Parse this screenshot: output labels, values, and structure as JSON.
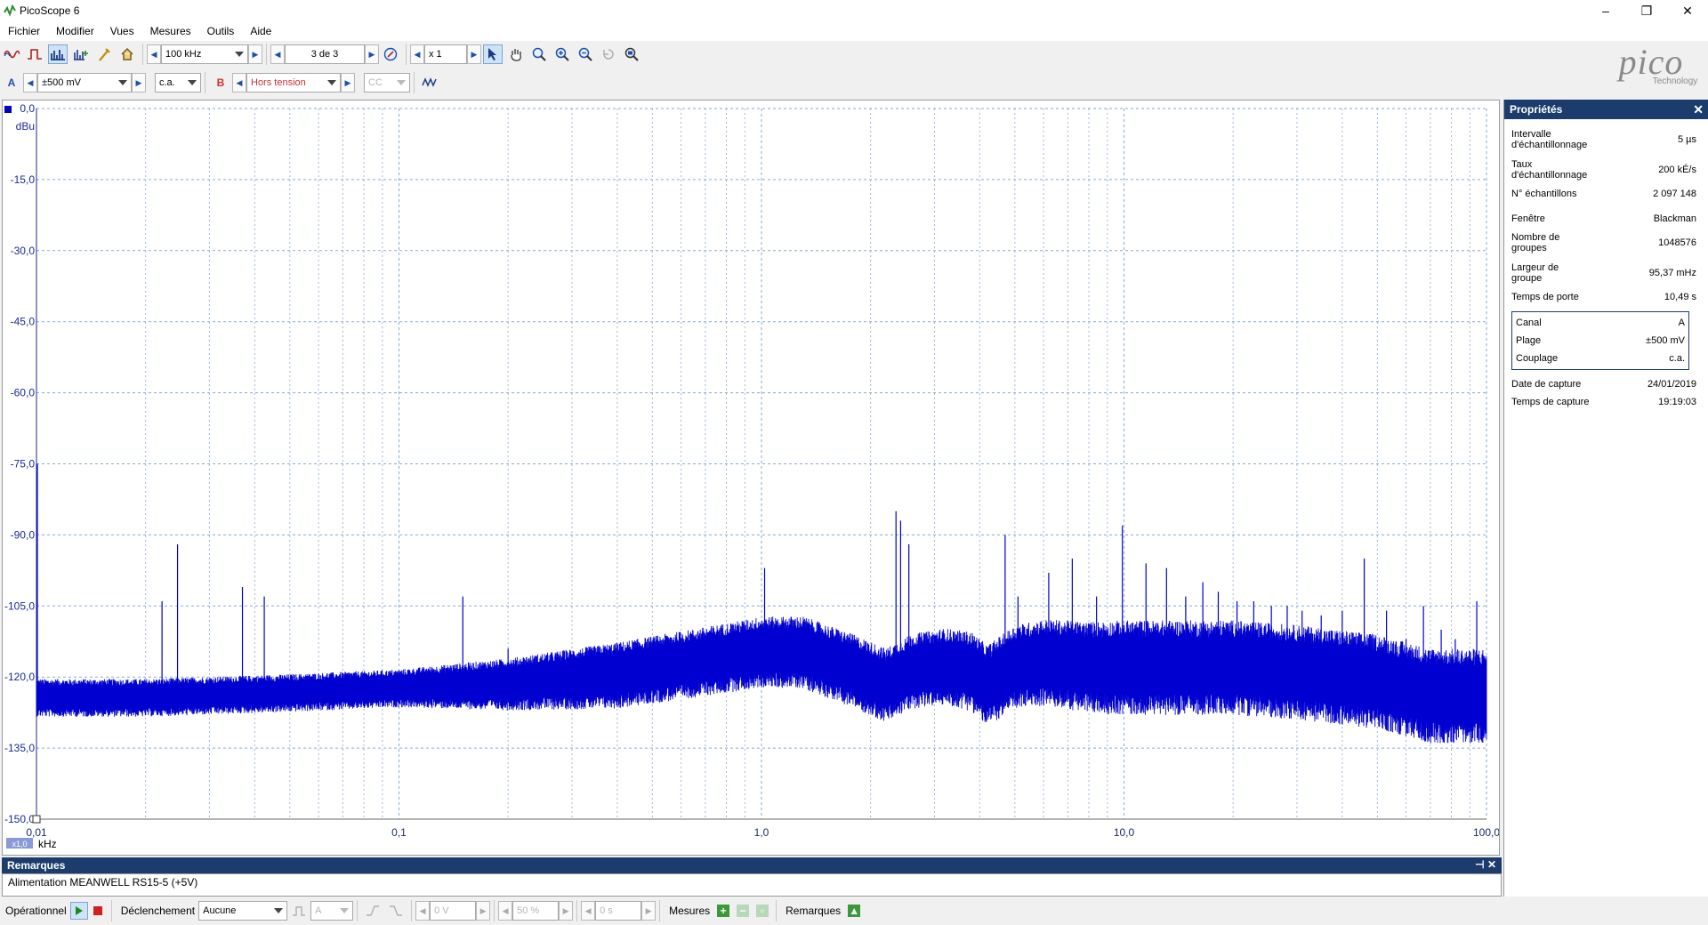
{
  "window": {
    "title": "PicoScope 6",
    "minimize": "–",
    "restore": "❐",
    "close": "✕"
  },
  "menu": [
    "Fichier",
    "Modifier",
    "Vues",
    "Mesures",
    "Outils",
    "Aide"
  ],
  "toolbar": {
    "timebase": "100 kHz",
    "buffer": "3 de 3",
    "zoom": "x 1"
  },
  "channels": {
    "a": {
      "label": "A",
      "range": "±500 mV",
      "coupling": "c.a."
    },
    "b": {
      "label": "B",
      "range": "Hors tension",
      "coupling": "CC"
    }
  },
  "logo": {
    "text": "pico",
    "sub": "Technology"
  },
  "chart_data": {
    "type": "line",
    "xscale": "log",
    "xlim": [
      0.01,
      100
    ],
    "ylim": [
      -150,
      0
    ],
    "ylabel": "dBu",
    "xlabel": "kHz",
    "yticks": [
      "0,0",
      "-15,0",
      "-30,0",
      "-45,0",
      "-60,0",
      "-75,0",
      "-90,0",
      "-105,0",
      "-120,0",
      "-135,0",
      "-150,0"
    ],
    "xticks": [
      "0,01",
      "0,1",
      "1,0",
      "10,0",
      "100,0"
    ],
    "zoom_badge": "x1,0",
    "grid": true,
    "series": [
      {
        "color": "#0000d0",
        "noise_floor": [
          [
            0.01,
            -124
          ],
          [
            0.02,
            -124
          ],
          [
            0.05,
            -123
          ],
          [
            0.1,
            -122
          ],
          [
            0.2,
            -121
          ],
          [
            0.4,
            -119
          ],
          [
            0.7,
            -116
          ],
          [
            1.0,
            -114
          ],
          [
            1.3,
            -114
          ],
          [
            1.8,
            -118
          ],
          [
            2.2,
            -121
          ],
          [
            2.6,
            -118
          ],
          [
            3.2,
            -117
          ],
          [
            3.8,
            -118
          ],
          [
            4.2,
            -121
          ],
          [
            5.0,
            -117
          ],
          [
            6.0,
            -116
          ],
          [
            8.0,
            -117
          ],
          [
            10,
            -117
          ],
          [
            15,
            -117
          ],
          [
            20,
            -117
          ],
          [
            30,
            -118
          ],
          [
            50,
            -120
          ],
          [
            70,
            -123
          ],
          [
            100,
            -123
          ]
        ],
        "noise_span_db": [
          [
            0.01,
            8
          ],
          [
            0.1,
            8
          ],
          [
            0.4,
            14
          ],
          [
            1.0,
            15
          ],
          [
            3.0,
            16
          ],
          [
            10,
            20
          ],
          [
            30,
            20
          ],
          [
            100,
            20
          ]
        ],
        "peaks": [
          [
            0.0245,
            -92
          ],
          [
            0.0222,
            -104
          ],
          [
            0.037,
            -101
          ],
          [
            0.0425,
            -103
          ],
          [
            0.15,
            -103
          ],
          [
            0.2,
            -114
          ],
          [
            1.02,
            -97
          ],
          [
            2.35,
            -85
          ],
          [
            2.42,
            -87
          ],
          [
            2.55,
            -92
          ],
          [
            4.7,
            -90
          ],
          [
            5.1,
            -103
          ],
          [
            6.2,
            -98
          ],
          [
            7.2,
            -95
          ],
          [
            8.4,
            -103
          ],
          [
            9.9,
            -88
          ],
          [
            11.5,
            -96
          ],
          [
            13.1,
            -97
          ],
          [
            14.8,
            -103
          ],
          [
            16.5,
            -100
          ],
          [
            18.2,
            -102
          ],
          [
            20.5,
            -104
          ],
          [
            22.8,
            -104
          ],
          [
            25.5,
            -105
          ],
          [
            28.2,
            -105
          ],
          [
            31.0,
            -106
          ],
          [
            35.0,
            -107
          ],
          [
            40.0,
            -106
          ],
          [
            46.0,
            -95
          ],
          [
            53.0,
            -106
          ],
          [
            60.0,
            -112
          ],
          [
            67.0,
            -105
          ],
          [
            75.0,
            -110
          ],
          [
            82.0,
            -112
          ],
          [
            94.0,
            -104
          ]
        ]
      }
    ]
  },
  "properties": {
    "title": "Propriétés",
    "close": "✕",
    "rows": [
      {
        "label": "Intervalle d'échantillonnage",
        "value": "5 µs"
      },
      {
        "label": "Taux d'échantillonnage",
        "value": "200 kÉ/s"
      },
      {
        "label": "N° échantillons",
        "value": "2 097 148"
      },
      {
        "label": "Fenêtre",
        "value": "Blackman"
      },
      {
        "label": "Nombre de groupes",
        "value": "1048576"
      },
      {
        "label": "Largeur de groupe",
        "value": "95,37 mHz"
      },
      {
        "label": "Temps de porte",
        "value": "10,49 s"
      }
    ],
    "channel_box": [
      {
        "label": "Canal",
        "value": "A"
      },
      {
        "label": "Plage",
        "value": "±500 mV"
      },
      {
        "label": "Couplage",
        "value": "c.a."
      }
    ],
    "capture": [
      {
        "label": "Date de capture",
        "value": "24/01/2019"
      },
      {
        "label": "Temps de capture",
        "value": "19:19:03"
      }
    ]
  },
  "remarks": {
    "title": "Remarques",
    "text": "Alimentation MEANWELL RS15-5 (+5V)",
    "icons": "⊣ ✕"
  },
  "status": {
    "mode": "Opérationnel",
    "trigger_label": "Déclenchement",
    "trigger_value": "Aucune",
    "trig_channel": "A",
    "trig_level": "0 V",
    "trig_pct": "50 %",
    "trig_delay": "0 s",
    "measures": "Mesures",
    "remarks": "Remarques"
  }
}
